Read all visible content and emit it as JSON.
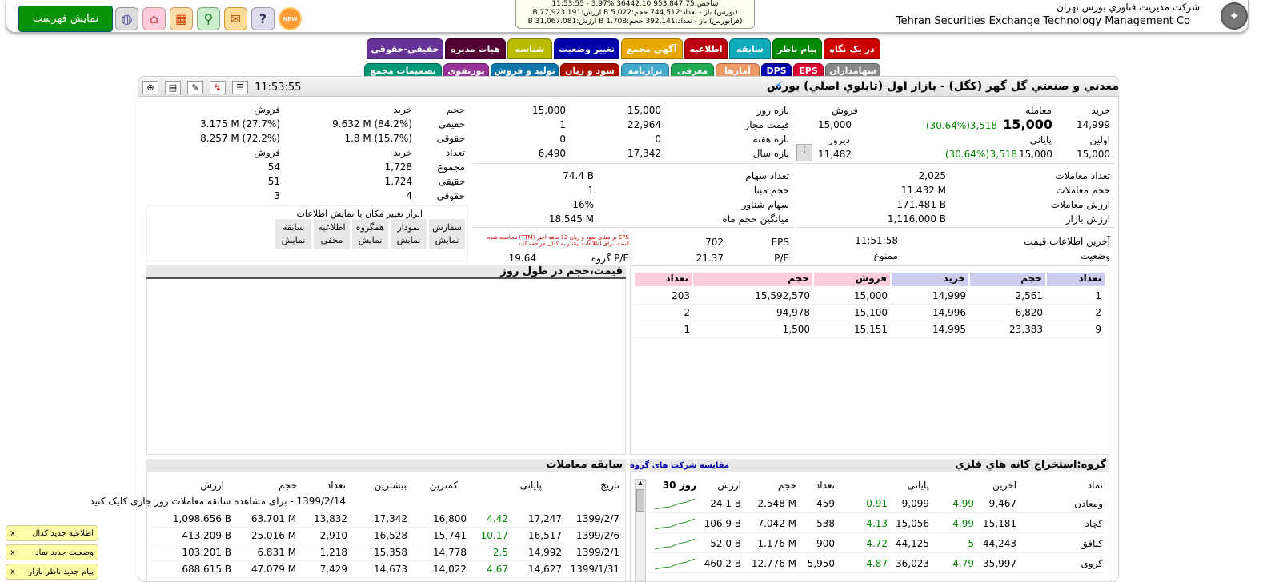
{
  "header": {
    "list_button": "نمایش فهرست",
    "company_fa": "شرکت مديريت فناوري بورس تهران",
    "company_en": "Tehran Securities Exchange Technology Management  Co",
    "new_badge": "NEW",
    "index_line1": "شاخص:953,847.75 36442.10 %3.97 - 11:53:55",
    "index_line2": "(بورس) باز - تعداد:744,512 حجم:B 5.022 ارزش:B 77,923.191",
    "index_line3": "(فرابورس) باز - تعداد:392,141 حجم:B 1.708 ارزش:B 31,067.081"
  },
  "tabs_row1": [
    "در یک نگاه",
    "پیام ناظر",
    "سابقه",
    "اطلاعیه",
    "آگهی مجمع",
    "تغییر وضعیت",
    "شناسه",
    "هیات مدیره",
    "حقیقی-حقوقی"
  ],
  "tabs_row2": [
    "سهامداران",
    "EPS",
    "DPS",
    "آمارها",
    "معرفی",
    "ترازنامه",
    "سود و زیان",
    "تولید و فروش",
    "پورتفوی",
    "تصمیمات مجمع"
  ],
  "title": {
    "name": "معدني و صنعتي گل گهر (كگل) - بازار اول (تابلوي اصلي) بورس",
    "time": "11:53:55"
  },
  "price": {
    "l_buy": "خرید",
    "l_trade": "معامله",
    "l_sell": "فروش",
    "buy": "14,999",
    "trade": "15,000",
    "trade_chg": "3,518",
    "trade_pct": "(30.64%)",
    "sell": "15,000",
    "l_first": "اولین",
    "l_last": "پایانی",
    "l_yest": "دیروز",
    "first": "15,000",
    "last": "15,000",
    "last_chg": "3,518",
    "last_pct": "(30.64%)",
    "yesterday": "11,482",
    "l_day": "بازه روز",
    "day_low": "15,000",
    "day_high": "15,000",
    "l_allowed": "قیمت مجاز",
    "allowed_low": "1",
    "allowed_high": "22,964",
    "l_week": "بازه هفته",
    "week_low": "0",
    "week_high": "0",
    "l_year": "بازه سال",
    "year_low": "6,490",
    "year_high": "17,342"
  },
  "stats": {
    "l_count": "تعداد معاملات",
    "count": "2,025",
    "l_volume": "حجم معاملات",
    "volume": "11.432 M",
    "l_value": "ارزش معاملات",
    "value": "171.481 B",
    "l_mcap": "ارزش بازار",
    "mcap": "1,116,000 B",
    "l_shares": "تعداد سهام",
    "shares": "74.4 B",
    "l_base": "حجم مبنا",
    "base": "1",
    "l_float": "سهام شناور",
    "float": "16%",
    "l_avgvol": "میانگین حجم ماه",
    "avgvol": "18.545 M",
    "l_lastinfo": "آخرین اطلاعات قیمت",
    "lastinfo": "11:51:58",
    "l_status": "وضعیت",
    "status": "ممنوع",
    "l_eps": "EPS",
    "eps": "702",
    "l_pe": "P/E",
    "pe": "21.37",
    "l_gpe": "P/E گروه",
    "gpe": "19.64",
    "eps_note": "EPS بر مبنای سود و زیان 12 ماهه اخیر (TTM) محاسبه شده است. برای اطلاعات بیشتر به کدال مراجعه کنید"
  },
  "client": {
    "h_vol": "حجم",
    "h_buy": "خرید",
    "h_sell": "فروش",
    "l_real": "حقیقی",
    "l_legal": "حقوقی",
    "real_buy": "9.632 M (84.2%)",
    "real_sell": "3.175 M (27.7%)",
    "legal_buy": "1.8 M (15.7%)",
    "legal_sell": "8.257 M (72.2%)",
    "h_cnt": "تعداد",
    "l_sum": "مجموع",
    "sum_buy": "1,728",
    "sum_sell": "54",
    "rcnt_buy": "1,724",
    "rcnt_sell": "51",
    "lcnt_buy": "4",
    "lcnt_sell": "3"
  },
  "tools": {
    "title": "ابزار تغییر مکان یا نمایش اطلاعات",
    "items": [
      [
        "سفارش",
        "نمایش"
      ],
      [
        "نمودار",
        "نمایش"
      ],
      [
        "همگروه",
        "نمایش"
      ],
      [
        "اطلاعیه",
        "مخفی"
      ],
      [
        "سابقه",
        "نمایش"
      ]
    ]
  },
  "chart": {
    "title": "قیمت،حجم در طول روز"
  },
  "orderbook": {
    "headers": [
      "تعداد",
      "حجم",
      "خرید",
      "فروش",
      "حجم",
      "تعداد"
    ],
    "rows": [
      [
        "1",
        "2,561",
        "14,999",
        "15,000",
        "15,592,570",
        "203"
      ],
      [
        "2",
        "6,820",
        "14,996",
        "15,100",
        "94,978",
        "2"
      ],
      [
        "9",
        "23,383",
        "14,995",
        "15,151",
        "1,500",
        "1"
      ]
    ]
  },
  "history": {
    "title": "سابقه معاملات",
    "headers": [
      "تاریخ",
      "پایانی",
      "",
      "کمترین",
      "بیشترین",
      "تعداد",
      "حجم",
      "ارزش"
    ],
    "notice": "1399/2/14 - برای مشاهده سابقه معاملات روز جاری کلیک کنید",
    "rows": [
      [
        "1399/2/7",
        "17,247",
        "4.42",
        "16,800",
        "17,342",
        "13,832",
        "63.701 M",
        "1,098.656 B"
      ],
      [
        "1399/2/6",
        "16,517",
        "10.17",
        "15,741",
        "16,528",
        "2,910",
        "25.016 M",
        "413.209 B"
      ],
      [
        "1399/2/1",
        "14,992",
        "2.5",
        "14,778",
        "15,358",
        "1,218",
        "6.831 M",
        "103.201 B"
      ],
      [
        "1399/1/31",
        "14,627",
        "4.67",
        "14,022",
        "14,673",
        "7,429",
        "47.079 M",
        "688.615 B"
      ]
    ]
  },
  "group": {
    "title": "گروه:استخراج کانه هاي فلزي",
    "compare": "مقایسه شرکت های گروه",
    "headers": [
      "نماد",
      "آخرین",
      "",
      "پایانی",
      "",
      "تعداد",
      "حجم",
      "ارزش",
      "30 روز"
    ],
    "rows": [
      [
        "ومعادن",
        "9,467",
        "4.99",
        "9,099",
        "0.91",
        "459",
        "2.548 M",
        "24.1 B"
      ],
      [
        "کچاد",
        "15,181",
        "4.99",
        "15,056",
        "4.13",
        "538",
        "7.042 M",
        "106.9 B"
      ],
      [
        "کبافق",
        "44,243",
        "5",
        "44,125",
        "4.72",
        "900",
        "1.176 M",
        "52.0 B"
      ],
      [
        "کروی",
        "35,997",
        "4.79",
        "36,023",
        "4.87",
        "5,950",
        "12.776 M",
        "460.2 B"
      ]
    ]
  },
  "notifications": [
    "اطلاعیه جدید کدال",
    "وضعیت جدید نماد",
    "پیام جدید ناظر بازار"
  ]
}
